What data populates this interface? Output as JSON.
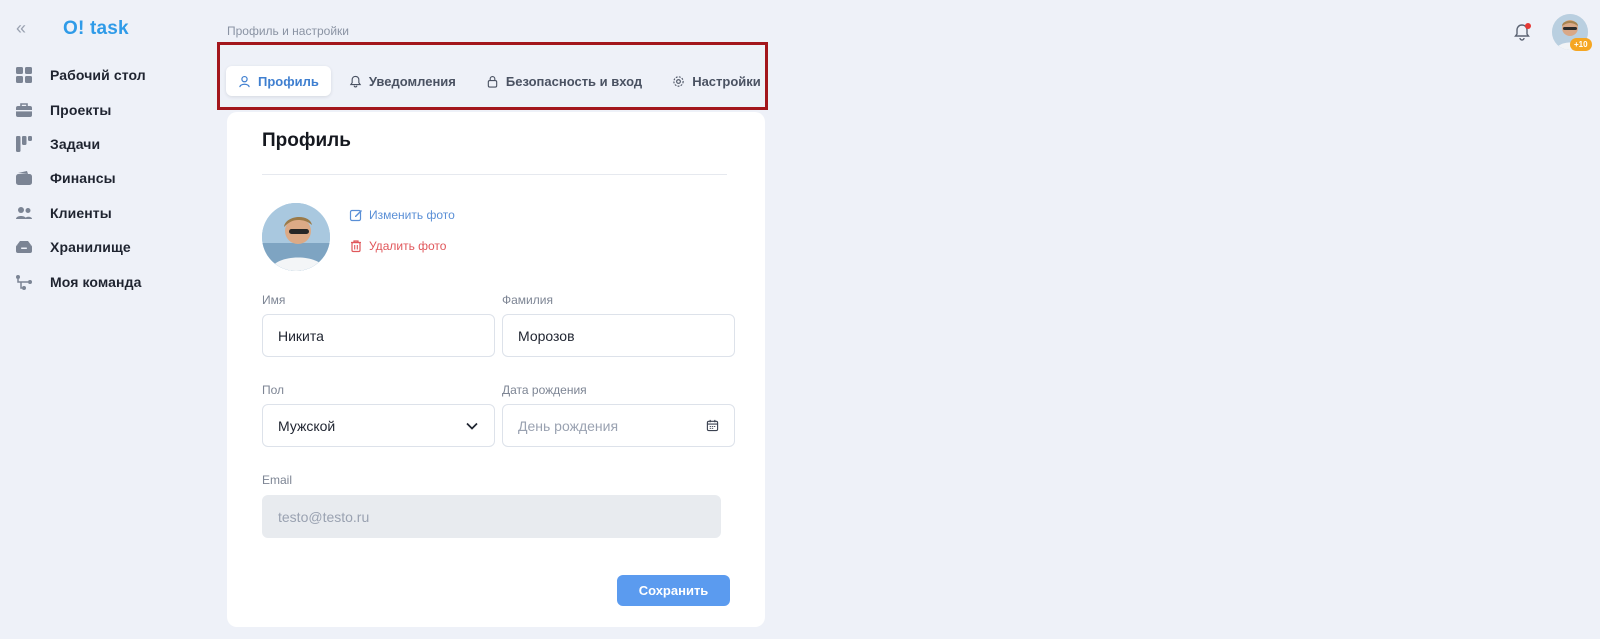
{
  "app": {
    "logo": "O! task",
    "collapse_glyph": "«"
  },
  "sidebar": {
    "items": [
      {
        "label": "Рабочий стол",
        "icon": "dashboard-grid-icon"
      },
      {
        "label": "Проекты",
        "icon": "briefcase-icon"
      },
      {
        "label": "Задачи",
        "icon": "kanban-icon"
      },
      {
        "label": "Финансы",
        "icon": "wallet-icon"
      },
      {
        "label": "Клиенты",
        "icon": "users-icon"
      },
      {
        "label": "Хранилище",
        "icon": "storage-box-icon"
      },
      {
        "label": "Моя команда",
        "icon": "team-tree-icon"
      }
    ]
  },
  "header": {
    "breadcrumb": "Профиль и настройки",
    "notification_icon": "bell-icon",
    "avatar_badge": "+10"
  },
  "tabs": [
    {
      "label": "Профиль",
      "icon": "user-icon",
      "active": true
    },
    {
      "label": "Уведомления",
      "icon": "bell-icon",
      "active": false
    },
    {
      "label": "Безопасность и вход",
      "icon": "lock-icon",
      "active": false
    },
    {
      "label": "Настройки",
      "icon": "gear-icon",
      "active": false
    }
  ],
  "profile": {
    "title": "Профиль",
    "change_photo": "Изменить фото",
    "delete_photo": "Удалить фото",
    "first_name_label": "Имя",
    "first_name_value": "Никита",
    "last_name_label": "Фамилия",
    "last_name_value": "Морозов",
    "gender_label": "Пол",
    "gender_value": "Мужской",
    "birthdate_label": "Дата рождения",
    "birthdate_placeholder": "День рождения",
    "email_label": "Email",
    "email_value": "testo@testo.ru",
    "save_label": "Сохранить"
  },
  "colors": {
    "accent": "#5b9bef",
    "logo": "#2f9be8",
    "danger": "#e0575b",
    "highlight_frame": "#a3161c",
    "notification_dot": "#e53935",
    "badge": "#f5a623"
  }
}
